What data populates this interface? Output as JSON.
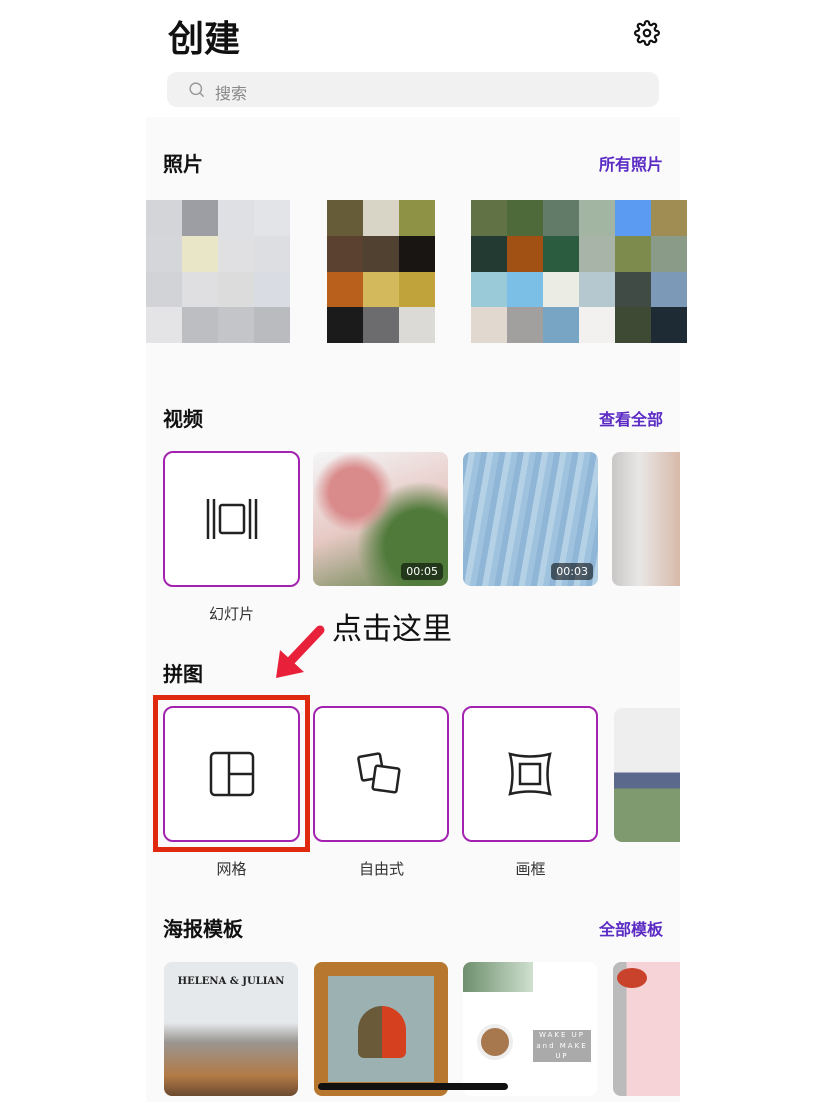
{
  "header": {
    "title": "创建",
    "settings_icon": "gear-icon"
  },
  "search": {
    "placeholder": "搜索"
  },
  "photos": {
    "title": "照片",
    "link": "所有照片",
    "mosaics": [
      [
        "#d3d5d9",
        "#9c9ea3",
        "#dfe0e3",
        "#e3e4e7",
        "#d5d6da",
        "#e9e6c8",
        "#e0e0e2",
        "#dcdee2",
        "#d1d3d6",
        "#dfdfe1",
        "#dcdcdc",
        "#d9dde3",
        "#e4e4e6",
        "#bdbec1",
        "#c4c5c8",
        "#b9bbbf"
      ],
      [
        "#675c38",
        "#d8d4c6",
        "#8e9245",
        "#5a4130",
        "#504130",
        "#181512",
        "#b8601c",
        "#d3b95b",
        "#c0a43b",
        "#1c1b1b",
        "#6c6b6d",
        "#dcdad6"
      ],
      [
        "#617345",
        "#4e6a3a",
        "#627a68",
        "#a2b5a2",
        "#5b9bf1",
        "#a08d53",
        "#233a33",
        "#a25115",
        "#2b5c3f",
        "#a9b4a9",
        "#7d8c4c",
        "#8a9c87",
        "#9acad8",
        "#7cbfe6",
        "#ebece3",
        "#b6c8cf",
        "#414b46",
        "#7d99b8",
        "#e1d9d0",
        "#a1a09e",
        "#78a5c4",
        "#f2f1ef",
        "#3e4a33",
        "#1e2b35"
      ]
    ]
  },
  "videos": {
    "title": "视频",
    "link": "查看全部",
    "slideshow_label": "幻灯片",
    "slideshow_icon": "slideshow-icon",
    "items": [
      {
        "duration": "00:05"
      },
      {
        "duration": "00:03"
      }
    ]
  },
  "annotation": {
    "text": "点击这里",
    "color": "#e8203a"
  },
  "collage": {
    "title": "拼图",
    "items": [
      {
        "label": "网格",
        "icon": "grid-layout-icon"
      },
      {
        "label": "自由式",
        "icon": "freeform-icon"
      },
      {
        "label": "画框",
        "icon": "frame-icon"
      }
    ]
  },
  "posters": {
    "title": "海报模板",
    "link": "全部模板",
    "items": [
      {
        "text": "HELENA & JULIAN"
      },
      {
        "text": ""
      },
      {
        "text": "WAKE UP and MAKE UP"
      },
      {
        "text": ""
      }
    ]
  },
  "colors": {
    "accent": "#5b2bc4",
    "tile_border": "#a323b0",
    "highlight": "#e02a10"
  }
}
